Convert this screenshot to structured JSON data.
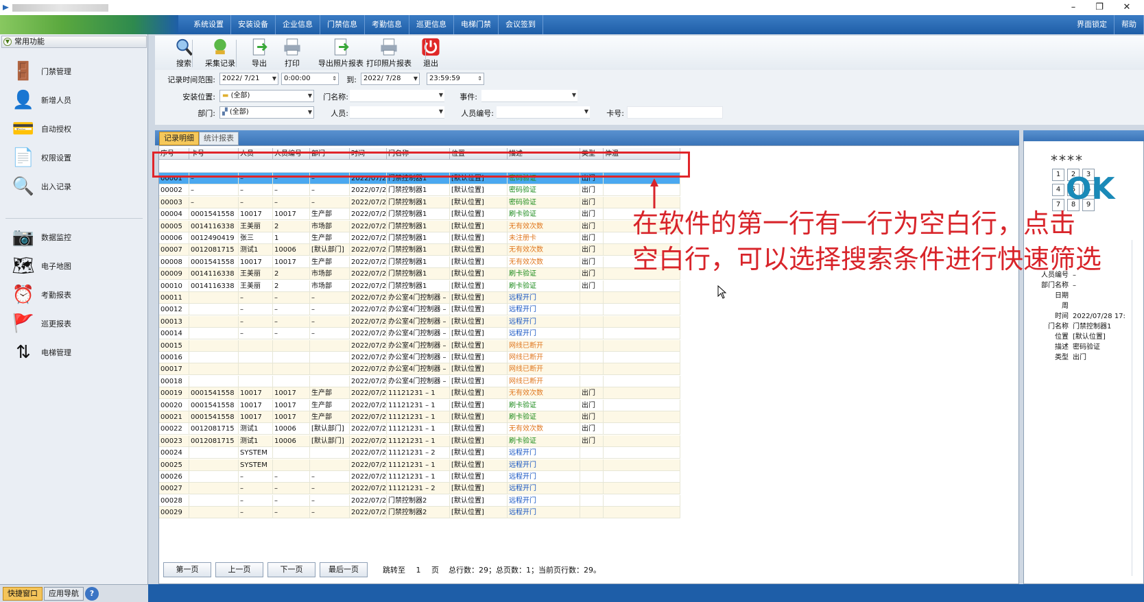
{
  "window": {
    "min": "–",
    "restore": "❐",
    "close": "✕"
  },
  "menu": {
    "items": [
      "系统设置",
      "安装设备",
      "企业信息",
      "门禁信息",
      "考勤信息",
      "巡更信息",
      "电梯门禁",
      "会议签到"
    ],
    "right": [
      "界面锁定",
      "帮助"
    ]
  },
  "sidebar": {
    "header": "常用功能",
    "items": [
      {
        "label": "门禁管理",
        "icon": "gate-icon"
      },
      {
        "label": "新增人员",
        "icon": "person-icon"
      },
      {
        "label": "自动授权",
        "icon": "card-icon"
      },
      {
        "label": "权限设置",
        "icon": "doc-icon"
      },
      {
        "label": "出入记录",
        "icon": "magnifier-icon"
      },
      {
        "label": "数据监控",
        "icon": "camera-icon"
      },
      {
        "label": "电子地图",
        "icon": "map-icon"
      },
      {
        "label": "考勤报表",
        "icon": "clock-icon"
      },
      {
        "label": "巡更报表",
        "icon": "patrol-icon"
      },
      {
        "label": "电梯管理",
        "icon": "elevator-icon"
      }
    ],
    "footer": {
      "tab1": "快捷窗口",
      "tab2": "应用导航",
      "help": "?"
    }
  },
  "toolbar": {
    "buttons": [
      {
        "label": "搜索"
      },
      {
        "label": "采集记录"
      },
      {
        "label": "导出"
      },
      {
        "label": "打印"
      },
      {
        "label": "导出照片报表"
      },
      {
        "label": "打印照片报表"
      },
      {
        "label": "退出"
      }
    ]
  },
  "filters": {
    "range_label": "记录时间范围:",
    "date_from": "2022/ 7/21",
    "time_from": "0:00:00",
    "to_label": "到:",
    "date_to": "2022/ 7/28",
    "time_to": "23:59:59",
    "location_label": "安装位置:",
    "location_value": "(全部)",
    "door_label": "门名称:",
    "event_label": "事件:",
    "dept_label": "部门:",
    "dept_value": "(全部)",
    "person_label": "人员:",
    "person_no_label": "人员编号:",
    "card_label": "卡号:"
  },
  "tabs": [
    "记录明细",
    "统计报表"
  ],
  "grid": {
    "headers": [
      "序号",
      "卡号",
      "人员",
      "人员编号",
      "部门",
      "时间",
      "门名称",
      "位置",
      "描述",
      "类型",
      "体温"
    ],
    "rows": [
      [
        "00001",
        "–",
        "–",
        "–",
        "–",
        "2022/07/2",
        "门禁控制器1",
        "[默认位置]",
        "密码验证",
        "出门",
        ""
      ],
      [
        "00002",
        "–",
        "–",
        "–",
        "–",
        "2022/07/2",
        "门禁控制器1",
        "[默认位置]",
        "密码验证",
        "出门",
        ""
      ],
      [
        "00003",
        "–",
        "–",
        "–",
        "–",
        "2022/07/2",
        "门禁控制器1",
        "[默认位置]",
        "密码验证",
        "出门",
        ""
      ],
      [
        "00004",
        "0001541558",
        "10017",
        "10017",
        "生产部",
        "2022/07/2",
        "门禁控制器1",
        "[默认位置]",
        "刷卡验证",
        "出门",
        ""
      ],
      [
        "00005",
        "0014116338",
        "王美丽",
        "2",
        "市场部",
        "2022/07/2",
        "门禁控制器1",
        "[默认位置]",
        "无有效次数",
        "出门",
        ""
      ],
      [
        "00006",
        "0012490419",
        "张三",
        "1",
        "生产部",
        "2022/07/2",
        "门禁控制器1",
        "[默认位置]",
        "未注册卡",
        "出门",
        ""
      ],
      [
        "00007",
        "0012081715",
        "测试1",
        "10006",
        "[默认部门]",
        "2022/07/2",
        "门禁控制器1",
        "[默认位置]",
        "无有效次数",
        "出门",
        ""
      ],
      [
        "00008",
        "0001541558",
        "10017",
        "10017",
        "生产部",
        "2022/07/2",
        "门禁控制器1",
        "[默认位置]",
        "无有效次数",
        "出门",
        ""
      ],
      [
        "00009",
        "0014116338",
        "王美丽",
        "2",
        "市场部",
        "2022/07/2",
        "门禁控制器1",
        "[默认位置]",
        "刷卡验证",
        "出门",
        ""
      ],
      [
        "00010",
        "0014116338",
        "王美丽",
        "2",
        "市场部",
        "2022/07/2",
        "门禁控制器1",
        "[默认位置]",
        "刷卡验证",
        "出门",
        ""
      ],
      [
        "00011",
        "",
        "–",
        "–",
        "–",
        "2022/07/2",
        "办公室4门控制器 –",
        "[默认位置]",
        "远程开门",
        "",
        ""
      ],
      [
        "00012",
        "",
        "–",
        "–",
        "–",
        "2022/07/2",
        "办公室4门控制器 –",
        "[默认位置]",
        "远程开门",
        "",
        ""
      ],
      [
        "00013",
        "",
        "–",
        "–",
        "–",
        "2022/07/2",
        "办公室4门控制器 –",
        "[默认位置]",
        "远程开门",
        "",
        ""
      ],
      [
        "00014",
        "",
        "–",
        "–",
        "–",
        "2022/07/2",
        "办公室4门控制器 –",
        "[默认位置]",
        "远程开门",
        "",
        ""
      ],
      [
        "00015",
        "",
        "",
        "",
        "",
        "2022/07/2",
        "办公室4门控制器 –",
        "[默认位置]",
        "网线已断开",
        "",
        ""
      ],
      [
        "00016",
        "",
        "",
        "",
        "",
        "2022/07/2",
        "办公室4门控制器 –",
        "[默认位置]",
        "网线已断开",
        "",
        ""
      ],
      [
        "00017",
        "",
        "",
        "",
        "",
        "2022/07/2",
        "办公室4门控制器 –",
        "[默认位置]",
        "网线已断开",
        "",
        ""
      ],
      [
        "00018",
        "",
        "",
        "",
        "",
        "2022/07/2",
        "办公室4门控制器 –",
        "[默认位置]",
        "网线已断开",
        "",
        ""
      ],
      [
        "00019",
        "0001541558",
        "10017",
        "10017",
        "生产部",
        "2022/07/2",
        "11121231 – 1",
        "[默认位置]",
        "无有效次数",
        "出门",
        ""
      ],
      [
        "00020",
        "0001541558",
        "10017",
        "10017",
        "生产部",
        "2022/07/2",
        "11121231 – 1",
        "[默认位置]",
        "刷卡验证",
        "出门",
        ""
      ],
      [
        "00021",
        "0001541558",
        "10017",
        "10017",
        "生产部",
        "2022/07/2",
        "11121231 – 1",
        "[默认位置]",
        "刷卡验证",
        "出门",
        ""
      ],
      [
        "00022",
        "0012081715",
        "测试1",
        "10006",
        "[默认部门]",
        "2022/07/2",
        "11121231 – 1",
        "[默认位置]",
        "无有效次数",
        "出门",
        ""
      ],
      [
        "00023",
        "0012081715",
        "测试1",
        "10006",
        "[默认部门]",
        "2022/07/2",
        "11121231 – 1",
        "[默认位置]",
        "刷卡验证",
        "出门",
        ""
      ],
      [
        "00024",
        "",
        "SYSTEM",
        "",
        "",
        "2022/07/2",
        "11121231 – 2",
        "[默认位置]",
        "远程开门",
        "",
        ""
      ],
      [
        "00025",
        "",
        "SYSTEM",
        "",
        "",
        "2022/07/2",
        "11121231 – 1",
        "[默认位置]",
        "远程开门",
        "",
        ""
      ],
      [
        "00026",
        "",
        "–",
        "–",
        "–",
        "2022/07/2",
        "11121231 – 1",
        "[默认位置]",
        "远程开门",
        "",
        ""
      ],
      [
        "00027",
        "",
        "–",
        "–",
        "–",
        "2022/07/2",
        "11121231 – 2",
        "[默认位置]",
        "远程开门",
        "",
        ""
      ],
      [
        "00028",
        "",
        "–",
        "–",
        "–",
        "2022/07/2",
        "门禁控制器2",
        "[默认位置]",
        "远程开门",
        "",
        ""
      ],
      [
        "00029",
        "",
        "–",
        "–",
        "–",
        "2022/07/2",
        "门禁控制器2",
        "[默认位置]",
        "远程开门",
        "",
        ""
      ]
    ]
  },
  "pager": {
    "first": "第一页",
    "prev": "上一页",
    "next": "下一页",
    "last": "最后一页",
    "goto_label": "跳转至",
    "page_value": "1",
    "page_unit": "页",
    "summary": "总行数：29；总页数：1；当前页行数：29。"
  },
  "keypad": {
    "stars": "****",
    "keys": [
      "1",
      "2",
      "3",
      "4",
      "5",
      "6",
      "7",
      "8",
      "9"
    ],
    "ok": "OK"
  },
  "detail": [
    {
      "k": "人员编号",
      "v": "–"
    },
    {
      "k": "部门名称",
      "v": "–"
    },
    {
      "k": "日期",
      "v": ""
    },
    {
      "k": "周",
      "v": ""
    },
    {
      "k": "时间",
      "v": "2022/07/28 17:"
    },
    {
      "k": "门名称",
      "v": "门禁控制器1"
    },
    {
      "k": "位置",
      "v": "[默认位置]"
    },
    {
      "k": "描述",
      "v": "密码验证"
    },
    {
      "k": "类型",
      "v": "出门"
    }
  ],
  "annotation": {
    "line1": "在软件的第一行有一行为空白行，点击",
    "line2": "空白行，可以选择搜索条件进行快速筛选"
  },
  "colors": {
    "accent_red": "#d8242a",
    "menu_blue": "#1e5ea8",
    "row_alt": "#fdf8e6",
    "selected": "#4aa8f0"
  }
}
